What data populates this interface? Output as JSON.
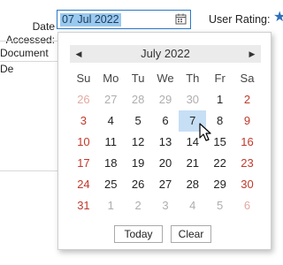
{
  "form": {
    "date_label": "Date Accessed:",
    "date_value": "07 Jul 2022",
    "rating_label": "User Rating:",
    "tab_partial": "Document De"
  },
  "calendar": {
    "month_title": "July 2022",
    "weekdays": [
      "Su",
      "Mo",
      "Tu",
      "We",
      "Th",
      "Fr",
      "Sa"
    ],
    "weeks": [
      [
        {
          "d": "26",
          "m": "other"
        },
        {
          "d": "27",
          "m": "other"
        },
        {
          "d": "28",
          "m": "other"
        },
        {
          "d": "29",
          "m": "other"
        },
        {
          "d": "30",
          "m": "other"
        },
        {
          "d": "1",
          "m": "cur"
        },
        {
          "d": "2",
          "m": "cur"
        }
      ],
      [
        {
          "d": "3",
          "m": "cur"
        },
        {
          "d": "4",
          "m": "cur"
        },
        {
          "d": "5",
          "m": "cur"
        },
        {
          "d": "6",
          "m": "cur"
        },
        {
          "d": "7",
          "m": "cur",
          "today": true
        },
        {
          "d": "8",
          "m": "cur"
        },
        {
          "d": "9",
          "m": "cur"
        }
      ],
      [
        {
          "d": "10",
          "m": "cur"
        },
        {
          "d": "11",
          "m": "cur"
        },
        {
          "d": "12",
          "m": "cur"
        },
        {
          "d": "13",
          "m": "cur"
        },
        {
          "d": "14",
          "m": "cur"
        },
        {
          "d": "15",
          "m": "cur"
        },
        {
          "d": "16",
          "m": "cur"
        }
      ],
      [
        {
          "d": "17",
          "m": "cur"
        },
        {
          "d": "18",
          "m": "cur"
        },
        {
          "d": "19",
          "m": "cur"
        },
        {
          "d": "20",
          "m": "cur"
        },
        {
          "d": "21",
          "m": "cur"
        },
        {
          "d": "22",
          "m": "cur"
        },
        {
          "d": "23",
          "m": "cur"
        }
      ],
      [
        {
          "d": "24",
          "m": "cur"
        },
        {
          "d": "25",
          "m": "cur"
        },
        {
          "d": "26",
          "m": "cur"
        },
        {
          "d": "27",
          "m": "cur"
        },
        {
          "d": "28",
          "m": "cur"
        },
        {
          "d": "29",
          "m": "cur"
        },
        {
          "d": "30",
          "m": "cur"
        }
      ],
      [
        {
          "d": "31",
          "m": "cur"
        },
        {
          "d": "1",
          "m": "other"
        },
        {
          "d": "2",
          "m": "other"
        },
        {
          "d": "3",
          "m": "other"
        },
        {
          "d": "4",
          "m": "other"
        },
        {
          "d": "5",
          "m": "other"
        },
        {
          "d": "6",
          "m": "other"
        }
      ]
    ],
    "today_button": "Today",
    "clear_button": "Clear"
  },
  "icons": {
    "prev": "chevron-left-icon",
    "next": "chevron-right-icon",
    "calendar": "calendar-icon",
    "star": "star-icon"
  },
  "colors": {
    "weekend": "#c0392b",
    "selection": "#99c9ef",
    "today_highlight": "#c6dff5",
    "accent": "#2f6fbf"
  }
}
